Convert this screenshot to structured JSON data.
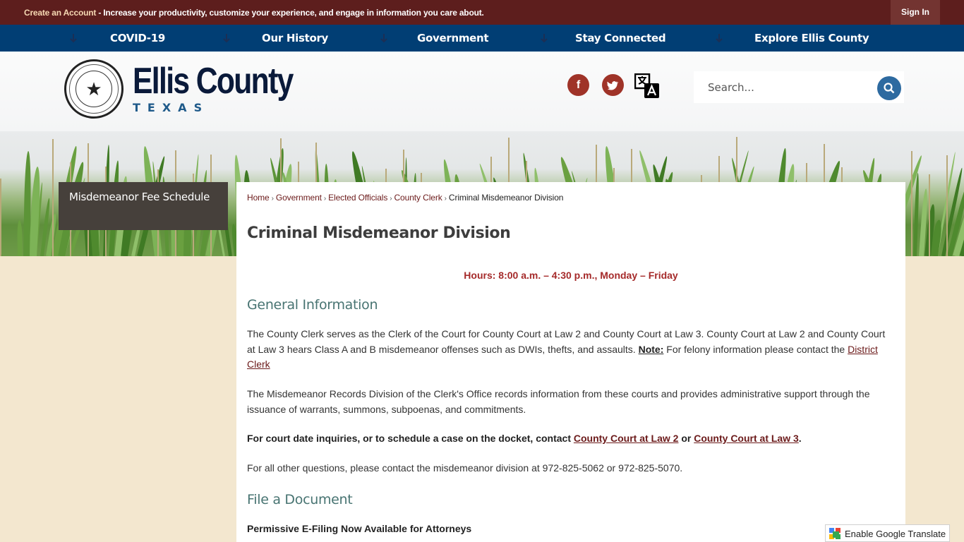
{
  "topbar": {
    "create_account_label": "Create an Account",
    "create_account_message": " - Increase your productivity, customize your experience, and engage in information you care about.",
    "signin_label": "Sign In"
  },
  "nav": {
    "items": [
      {
        "label": "COVID-19"
      },
      {
        "label": "Our History"
      },
      {
        "label": "Government"
      },
      {
        "label": "Stay Connected"
      },
      {
        "label": "Explore Ellis County"
      }
    ]
  },
  "header": {
    "brand_name": "Ellis County",
    "brand_sub": "TEXAS",
    "seal_icon": "county-seal",
    "social": [
      {
        "name": "facebook",
        "glyph": "f"
      },
      {
        "name": "twitter",
        "glyph": "t"
      }
    ],
    "translate_icon": "translate-icon",
    "search": {
      "placeholder": "Search..."
    }
  },
  "sidenav": {
    "items": [
      {
        "label": "Misdemeanor Fee Schedule"
      }
    ]
  },
  "breadcrumb": {
    "items": [
      "Home",
      "Government",
      "Elected Officials",
      "County Clerk"
    ],
    "current": "Criminal Misdemeanor Division",
    "separator": "›"
  },
  "page": {
    "title": "Criminal Misdemeanor Division",
    "hours": "Hours: 8:00 a.m. – 4:30 p.m., Monday – Friday",
    "general_heading": "General Information",
    "para1_text": "The County Clerk serves as the Clerk of the Court for County Court at Law 2 and County Court at Law 3.  County Court at Law 2 and County Court at Law 3 hears Class A and B misdemeanor offenses such as DWIs, thefts, and assaults.  ",
    "para1_note": "Note:",
    "para1_after_note": " For felony information please contact the ",
    "para1_link": "District Clerk",
    "para2": "The Misdemeanor Records Division of the Clerk's Office records information from these courts and provides administrative support through the issuance of warrants, summons, subpoenas, and commitments.",
    "para3_text": "For court date inquiries, or to schedule a case on the docket, contact ",
    "para3_link1": "County Court at Law 2",
    "para3_or": " or ",
    "para3_link2": "County Court at Law 3",
    "para3_end": ".",
    "para4": "For all other questions, please contact the misdemeanor division at 972-825-5062 or 972-825-5070.",
    "file_heading": "File a Document",
    "efiling": "Permissive E-Filing Now Available for Attorneys"
  },
  "google_translate": {
    "label": "Enable Google Translate"
  },
  "colors": {
    "topbar": "#5d1e1d",
    "nav": "#013e74",
    "social": "#9f3328",
    "search_button": "#2d6aa0",
    "heading": "#487472",
    "hours": "#a52a2a",
    "link": "#6b1a1a"
  }
}
